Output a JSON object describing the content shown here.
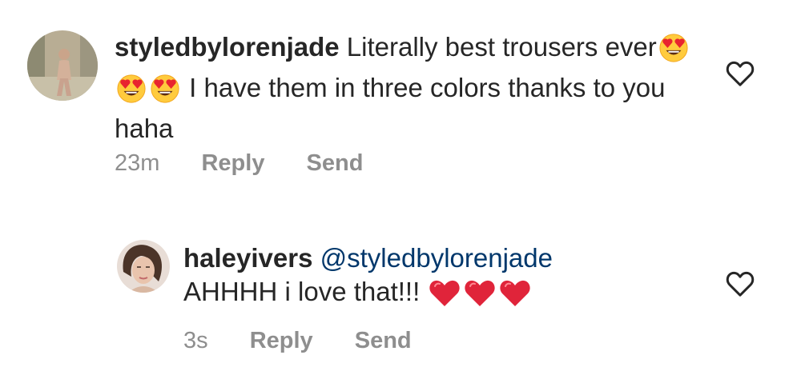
{
  "comments": [
    {
      "username": "styledbylorenjade",
      "text_before_emoji": "Literally best trousers ever",
      "emoji": [
        "heart-eyes-face",
        "heart-eyes-face",
        "heart-eyes-face"
      ],
      "text_after_emoji": "I have them in three colors thanks to you haha",
      "time": "23m",
      "reply_label": "Reply",
      "send_label": "Send"
    },
    {
      "username": "haleyivers",
      "mention": "@styledbylorenjade",
      "text": "AHHHH i love that!!!",
      "emoji": [
        "red-heart",
        "red-heart",
        "red-heart"
      ],
      "time": "3s",
      "reply_label": "Reply",
      "send_label": "Send"
    }
  ],
  "colors": {
    "text": "#262626",
    "meta": "#8e8e8e",
    "mention": "#00376b",
    "heart": "#e0243a"
  }
}
